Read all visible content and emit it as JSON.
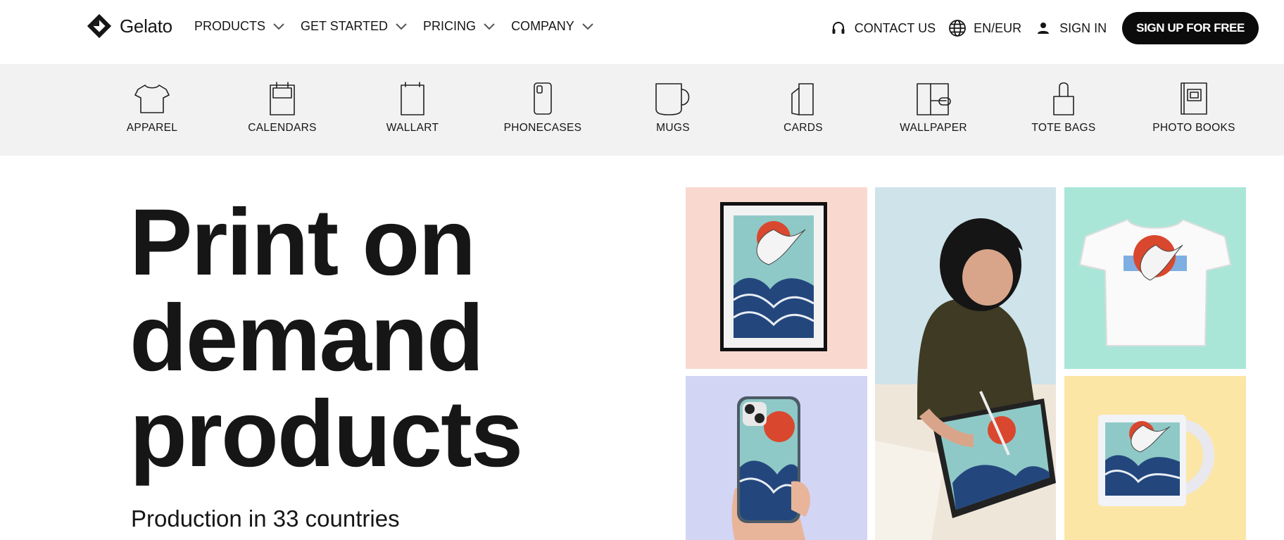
{
  "brand": {
    "name": "Gelato",
    "logo_icon": "gelato-diamond-logo"
  },
  "nav": {
    "items": [
      {
        "label": "PRODUCTS"
      },
      {
        "label": "GET STARTED"
      },
      {
        "label": "PRICING"
      },
      {
        "label": "COMPANY"
      }
    ]
  },
  "right_nav": {
    "contact": "CONTACT US",
    "locale": "EN/EUR",
    "sign_in": "SIGN IN",
    "sign_up": "SIGN UP FOR FREE"
  },
  "categories": [
    {
      "label": "APPAREL",
      "icon": "tshirt-icon"
    },
    {
      "label": "CALENDARS",
      "icon": "calendar-icon"
    },
    {
      "label": "WALLART",
      "icon": "wallart-icon"
    },
    {
      "label": "PHONECASES",
      "icon": "phonecase-icon"
    },
    {
      "label": "MUGS",
      "icon": "mug-icon"
    },
    {
      "label": "CARDS",
      "icon": "cards-icon"
    },
    {
      "label": "WALLPAPER",
      "icon": "wallpaper-icon"
    },
    {
      "label": "TOTE BAGS",
      "icon": "tote-bag-icon"
    },
    {
      "label": "PHOTO BOOKS",
      "icon": "photo-book-icon"
    }
  ],
  "hero": {
    "title_lines": [
      "Print on",
      "demand",
      "products"
    ],
    "subtitle": "Production in 33 countries"
  },
  "colors": {
    "text": "#161616",
    "category_bar": "#f2f2f2",
    "signup_button": "#0b0b0b",
    "tile_poster_bg": "#f9d9cf",
    "tile_tshirt_bg": "#a9e6d8",
    "tile_phone_bg": "#d3d5f5",
    "tile_mug_bg": "#fce6a6",
    "sun_red": "#d9482e",
    "wave_blue": "#23477d"
  }
}
